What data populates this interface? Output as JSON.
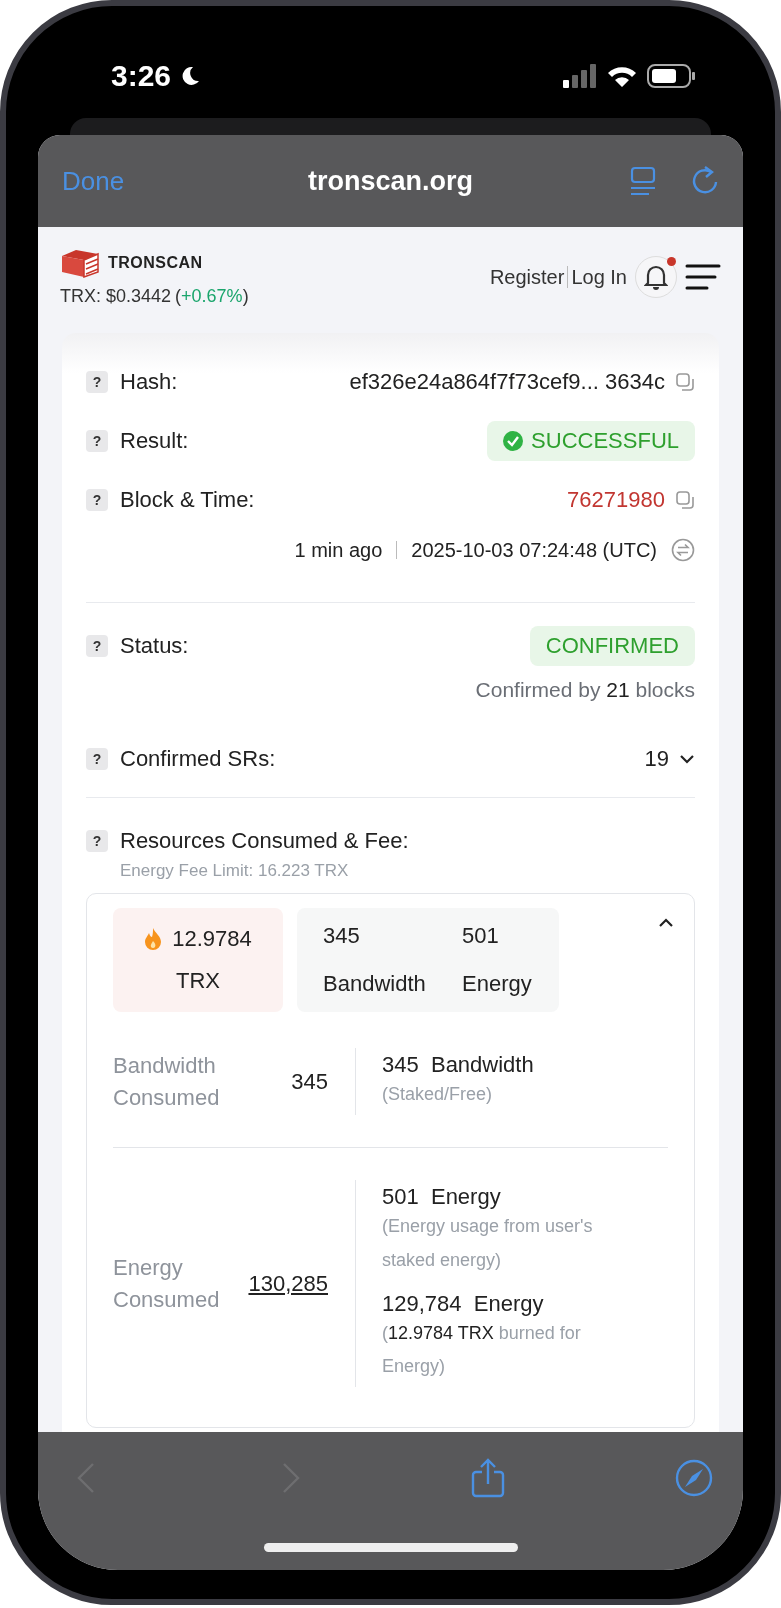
{
  "status_bar": {
    "time": "3:26"
  },
  "browser": {
    "done": "Done",
    "title": "tronscan.org"
  },
  "site_header": {
    "logo": "TRONSCAN",
    "price": "TRX: $0.3442",
    "change_parts": [
      "(",
      "+0.67%",
      ")"
    ],
    "register": "Register",
    "login": "Log In",
    "unread": true
  },
  "hash": {
    "hint": "?",
    "label": "Hash:",
    "value": "ef326e24a864f7f73cef9...  3634c"
  },
  "result": {
    "hint": "?",
    "label": "Result:",
    "value": "SUCCESSFUL"
  },
  "block": {
    "hint": "?",
    "label": "Block & Time:",
    "value": "76271980",
    "age": "1 min ago",
    "timestamp": "2025-10-03 07:24:48 (UTC)"
  },
  "status": {
    "hint": "?",
    "label": "Status:",
    "value": "CONFIRMED",
    "confirmed_prefix": "Confirmed by",
    "confirmed_count": "21",
    "confirmed_suffix": "blocks"
  },
  "confirmed_srs": {
    "hint": "?",
    "label": "Confirmed SRs:",
    "value": "19",
    "expanded": false
  },
  "resources": {
    "hint": "?",
    "label": "Resources Consumed & Fee:",
    "energy_fee_limit": "Energy Fee Limit: 16.223 TRX",
    "expanded": true,
    "fee": {
      "amount": "12.9784",
      "unit": "TRX"
    },
    "totals": [
      {
        "amount": "345",
        "unit": "Bandwidth"
      },
      {
        "amount": "501",
        "unit": "Energy"
      }
    ],
    "consumed": [
      {
        "label": "Bandwidth Consumed",
        "value": "345",
        "underlined": false,
        "details": [
          {
            "amount": "345",
            "unit": "Bandwidth",
            "note": "(Staked/Free)"
          }
        ]
      },
      {
        "label": "Energy Consumed",
        "value": "130,285",
        "underlined": true,
        "details": [
          {
            "amount": "501",
            "unit": "Energy",
            "note": "(Energy usage from user's staked energy)"
          },
          {
            "amount": "129,784",
            "unit": "Energy",
            "note": "(**12.9784 TRX** burned for Energy)"
          }
        ]
      }
    ]
  },
  "toolbar": {
    "back_disabled": true,
    "forward_disabled": true
  }
}
